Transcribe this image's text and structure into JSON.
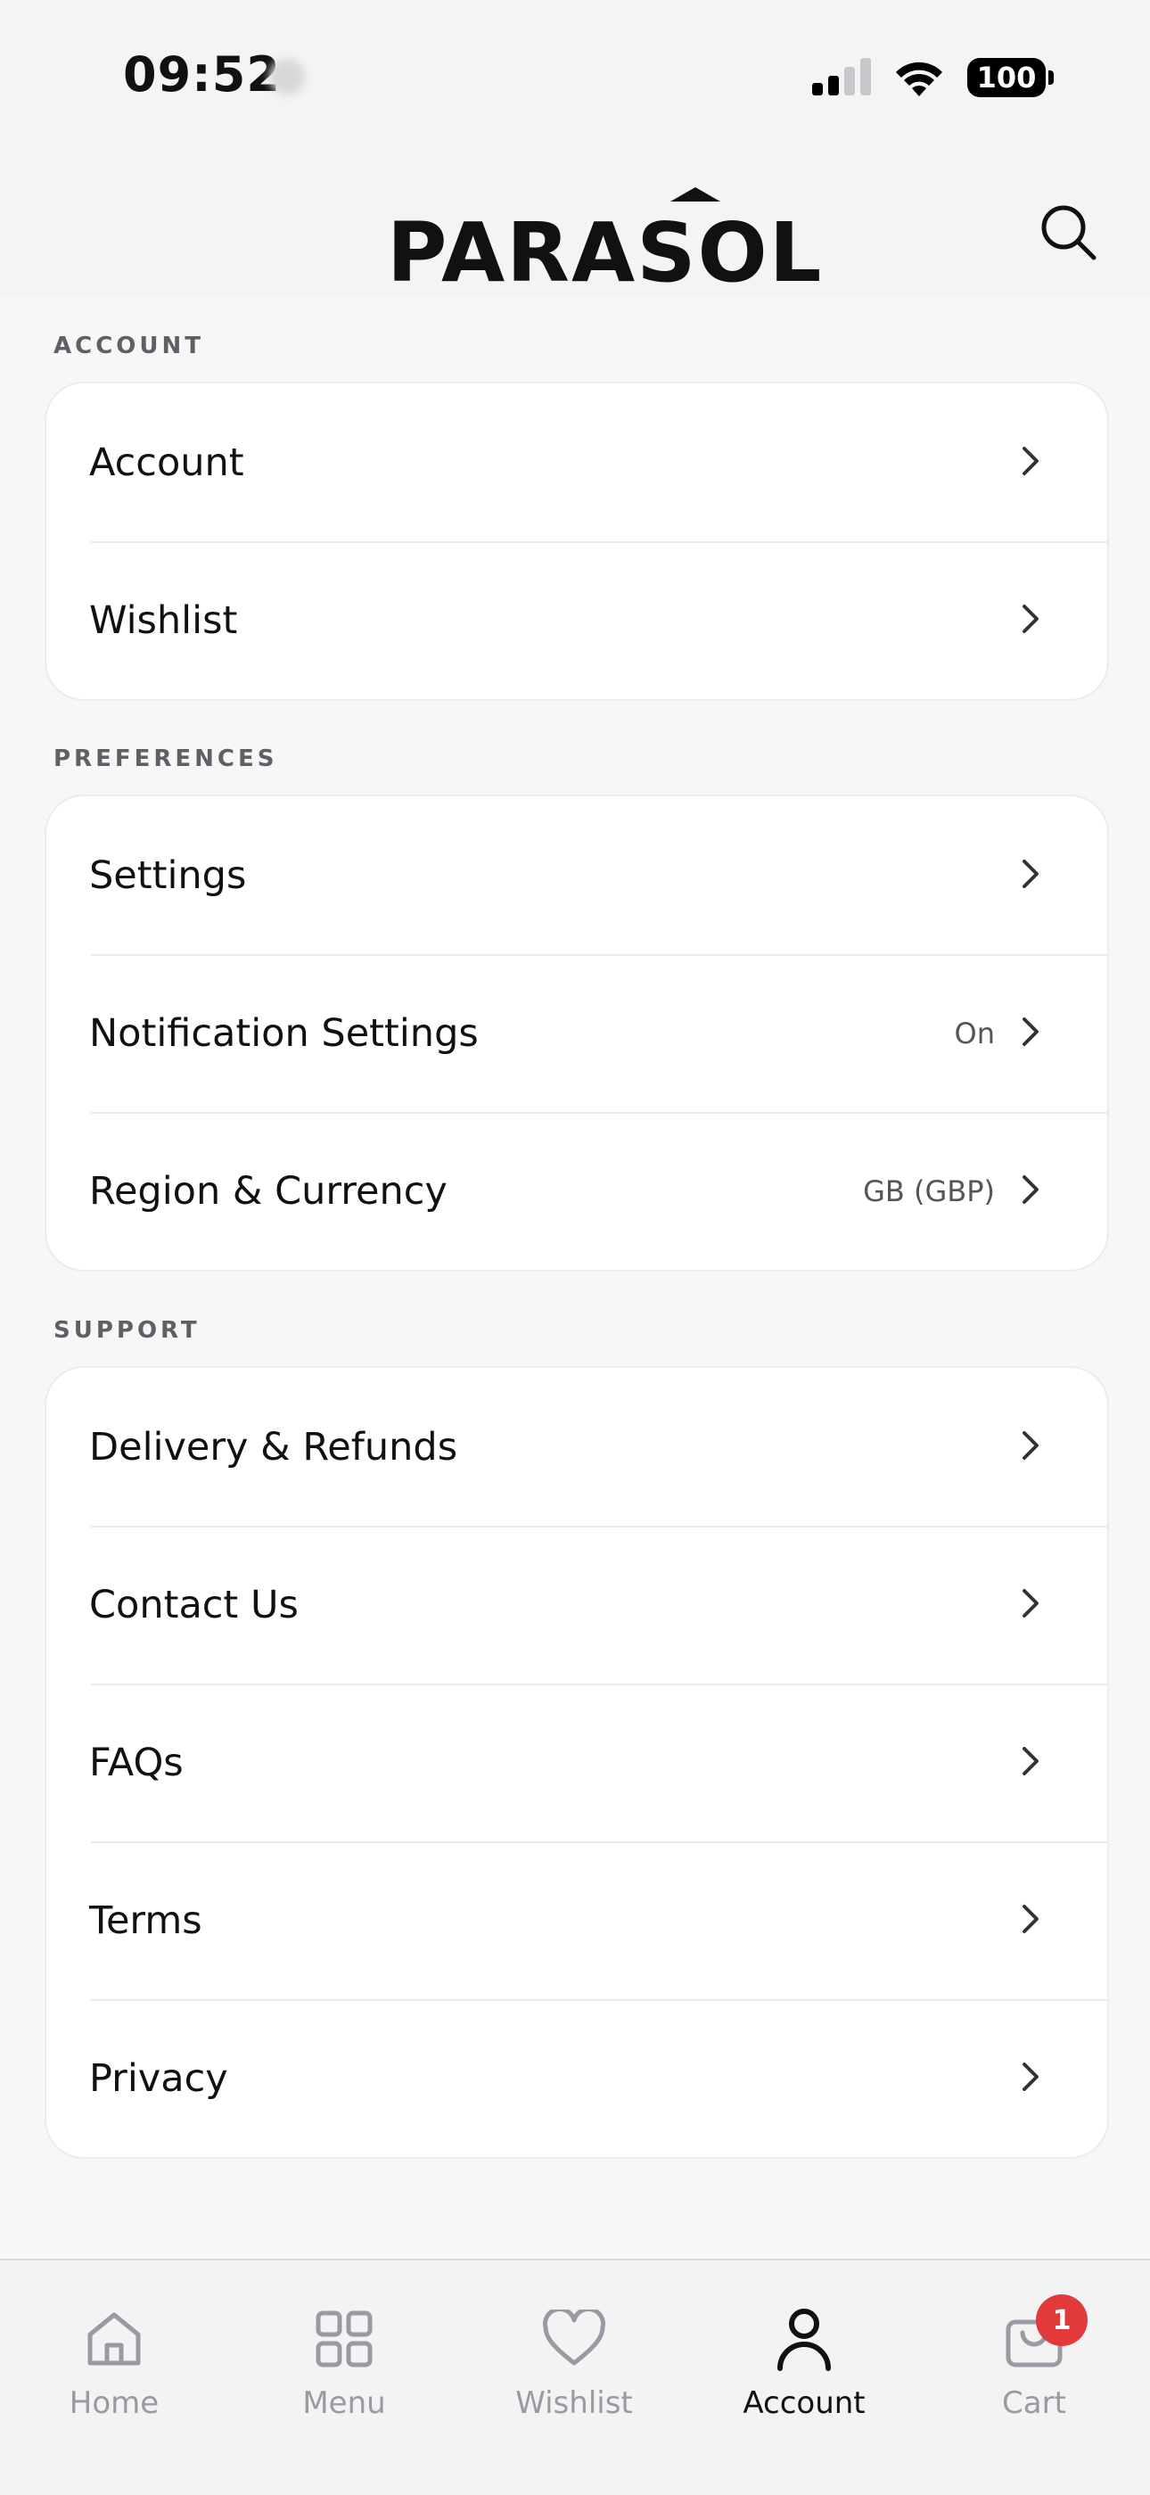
{
  "status_bar": {
    "time": "09:52",
    "battery": "100"
  },
  "header": {
    "logo_text": "PARASOL",
    "search_icon": "search-icon"
  },
  "sections": [
    {
      "title": "ACCOUNT",
      "items": [
        {
          "label": "Account",
          "value": ""
        },
        {
          "label": "Wishlist",
          "value": ""
        }
      ]
    },
    {
      "title": "PREFERENCES",
      "items": [
        {
          "label": "Settings",
          "value": ""
        },
        {
          "label": "Notification Settings",
          "value": "On"
        },
        {
          "label": "Region & Currency",
          "value": "GB (GBP)"
        }
      ]
    },
    {
      "title": "SUPPORT",
      "items": [
        {
          "label": "Delivery & Refunds",
          "value": ""
        },
        {
          "label": "Contact Us",
          "value": ""
        },
        {
          "label": "FAQs",
          "value": ""
        },
        {
          "label": "Terms",
          "value": ""
        },
        {
          "label": "Privacy",
          "value": ""
        }
      ]
    }
  ],
  "tab_bar": {
    "tabs": [
      {
        "label": "Home",
        "icon": "home-icon",
        "active": false
      },
      {
        "label": "Menu",
        "icon": "grid-icon",
        "active": false
      },
      {
        "label": "Wishlist",
        "icon": "heart-icon",
        "active": false
      },
      {
        "label": "Account",
        "icon": "user-icon",
        "active": true
      },
      {
        "label": "Cart",
        "icon": "cart-icon",
        "active": false,
        "badge": "1"
      }
    ]
  },
  "colors": {
    "badge": "#e23a3a",
    "active_tab": "#111111",
    "inactive_tab": "#9a9aa2"
  }
}
